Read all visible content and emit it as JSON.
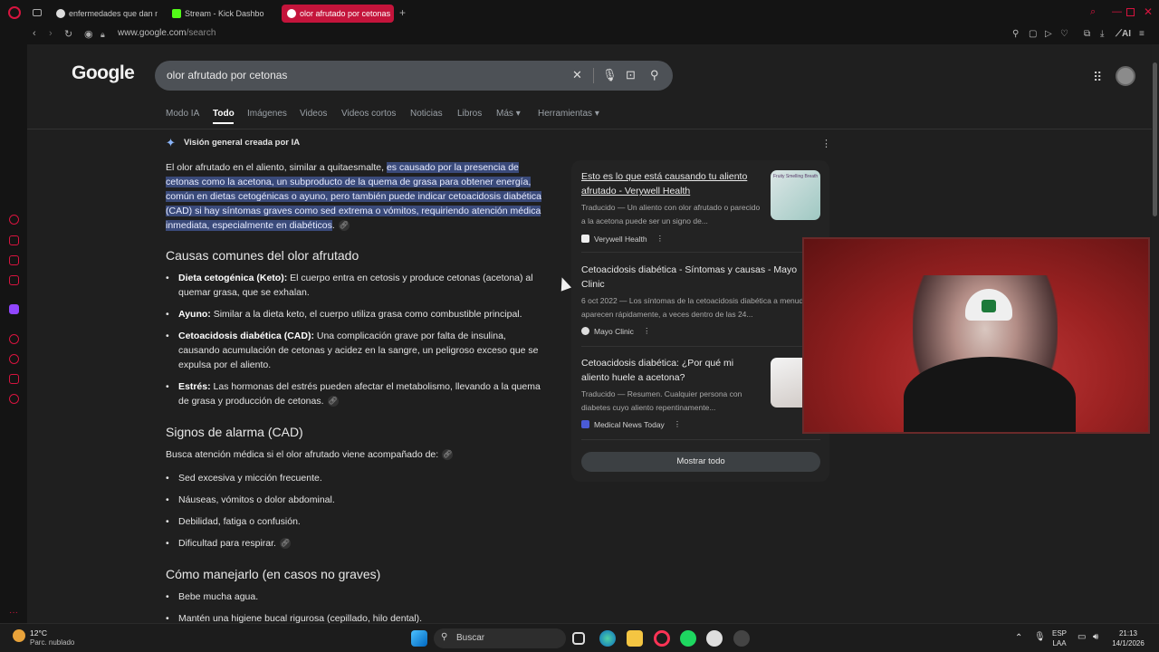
{
  "browser": {
    "tabs": [
      {
        "label": "enfermedades que dan ma",
        "active": false
      },
      {
        "label": "Stream - Kick Dashbo",
        "active": false
      },
      {
        "label": "olor afrutado por cetonas",
        "active": true
      }
    ],
    "url_host": "www.google.com",
    "url_path": "/search",
    "ai_label": "AI"
  },
  "google": {
    "logo": "Google",
    "query": "olor afrutado por cetonas",
    "tabs": [
      "Modo IA",
      "Todo",
      "Imágenes",
      "Videos",
      "Videos cortos",
      "Noticias",
      "Libros",
      "Más",
      "Herramientas"
    ],
    "selected_tab": "Todo"
  },
  "ai_overview": {
    "header": "Visión general creada por IA",
    "intro_plain": "El olor afrutado en el aliento, similar a quitaesmalte, ",
    "intro_highlight": "es causado por la presencia de cetonas como la acetona, un subproducto de la quema de grasa para obtener energía, común en dietas cetogénicas o ayuno, pero también puede indicar cetoacidosis diabética (CAD) si hay síntomas graves como sed extrema o vómitos, requiriendo atención médica inmediata, especialmente en diabéticos",
    "intro_end": ".",
    "section1_title": "Causas comunes del olor afrutado",
    "causes": [
      {
        "term": "Dieta cetogénica (Keto):",
        "text": " El cuerpo entra en cetosis y produce cetonas (acetona) al quemar grasa, que se exhalan."
      },
      {
        "term": "Ayuno:",
        "text": " Similar a la dieta keto, el cuerpo utiliza grasa como combustible principal."
      },
      {
        "term": "Cetoacidosis diabética (CAD):",
        "text": " Una complicación grave por falta de insulina, causando acumulación de cetonas y acidez en la sangre, un peligroso exceso que se expulsa por el aliento."
      },
      {
        "term": "Estrés:",
        "text": " Las hormonas del estrés pueden afectar el metabolismo, llevando a la quema de grasa y producción de cetonas."
      }
    ],
    "section2_title": "Signos de alarma (CAD)",
    "section2_intro": "Busca atención médica si el olor afrutado viene acompañado de:",
    "signs": [
      "Sed excesiva y micción frecuente.",
      "Náuseas, vómitos o dolor abdominal.",
      "Debilidad, fatiga o confusión.",
      "Dificultad para respirar."
    ],
    "section3_title": "Cómo manejarlo (en casos no graves)",
    "manage": [
      "Bebe mucha agua.",
      "Mantén una higiene bucal rigurosa (cepillado, hilo dental)."
    ]
  },
  "sources": {
    "items": [
      {
        "title": "Esto es lo que está causando tu aliento afrutado - Verywell Health",
        "snippet": "Traducido — Un aliento con olor afrutado o parecido a la acetona puede ser un signo de...",
        "source": "Verywell Health"
      },
      {
        "title": "Cetoacidosis diabética - Síntomas y causas - Mayo Clinic",
        "snippet": "6 oct 2022 — Los síntomas de la cetoacidosis diabética a menudo aparecen rápidamente, a veces dentro de las 24...",
        "source": "Mayo Clinic"
      },
      {
        "title": "Cetoacidosis diabética: ¿Por qué mi aliento huele a acetona?",
        "snippet": "Traducido — Resumen. Cualquier persona con diabetes cuyo aliento repentinamente...",
        "source": "Medical News Today"
      }
    ],
    "show_all": "Mostrar todo",
    "thumb1_text": "Fruity Smelling Breath"
  },
  "taskbar": {
    "temp": "12°C",
    "condition": "Parc. nublado",
    "search": "Buscar",
    "lang1": "ESP",
    "lang2": "LAA",
    "time": "21:13",
    "date": "14/1/2026"
  },
  "colors": {
    "accent": "#c4143b",
    "highlight": "#3a4a7a",
    "link": "#8ab4f8"
  }
}
